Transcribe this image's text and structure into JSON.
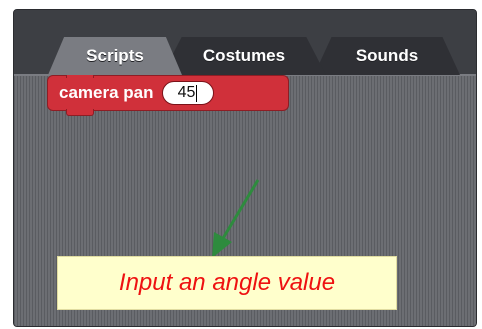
{
  "tabs": [
    {
      "label": "Scripts",
      "active": true
    },
    {
      "label": "Costumes",
      "active": false
    },
    {
      "label": "Sounds",
      "active": false
    }
  ],
  "block": {
    "label": "camera pan",
    "input_value": "45",
    "color": "#d0303a"
  },
  "callout": {
    "text": "Input an angle value",
    "text_color": "#ee1111",
    "background": "#ffffcc"
  },
  "arrow": {
    "color": "#2e8b3e",
    "icon": "arrow-icon"
  }
}
